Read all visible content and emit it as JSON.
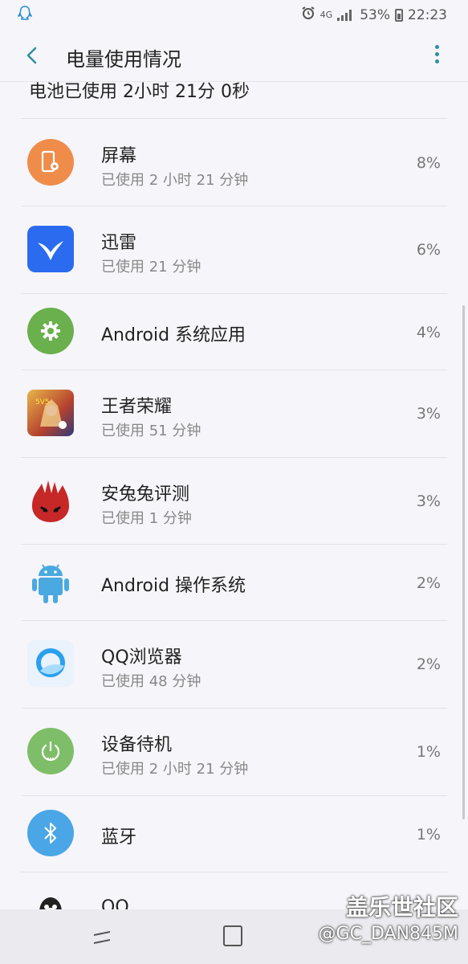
{
  "status_bar": {
    "network": "4G",
    "battery_percent": "53%",
    "time": "22:23",
    "icons": [
      "qq-notification-icon",
      "alarm-icon",
      "signal-icon",
      "battery-icon"
    ]
  },
  "app_bar": {
    "title": "电量使用情况",
    "back_icon": "chevron-left-icon",
    "more_icon": "more-vertical-icon"
  },
  "summary": "电池已使用 2小时 21分 0秒",
  "items": [
    {
      "name": "屏幕",
      "usage": "已使用 2 小时 21 分钟",
      "percent": "8%",
      "icon": "screen-icon",
      "color": "#ef8c4a"
    },
    {
      "name": "迅雷",
      "usage": "已使用 21 分钟",
      "percent": "6%",
      "icon": "xunlei-icon",
      "color": "#2a6bf0"
    },
    {
      "name": "Android 系统应用",
      "usage": "",
      "percent": "4%",
      "icon": "android-system-app-icon",
      "color": "#6ab04c"
    },
    {
      "name": "王者荣耀",
      "usage": "已使用 51 分钟",
      "percent": "3%",
      "icon": "honor-of-kings-icon",
      "color": "#b5412e"
    },
    {
      "name": "安兔兔评测",
      "usage": "已使用 1 分钟",
      "percent": "3%",
      "icon": "antutu-icon",
      "color": "#c62828"
    },
    {
      "name": "Android 操作系统",
      "usage": "",
      "percent": "2%",
      "icon": "android-os-icon",
      "color": "#4aa9e0"
    },
    {
      "name": "QQ浏览器",
      "usage": "已使用 48 分钟",
      "percent": "2%",
      "icon": "qq-browser-icon",
      "color": "#2aa0ef"
    },
    {
      "name": "设备待机",
      "usage": "已使用 2 小时 21 分钟",
      "percent": "1%",
      "icon": "power-standby-icon",
      "color": "#7fbe68"
    },
    {
      "name": "蓝牙",
      "usage": "",
      "percent": "1%",
      "icon": "bluetooth-icon",
      "color": "#4aa6e6"
    },
    {
      "name": "QQ",
      "usage": "",
      "percent": "",
      "icon": "qq-icon",
      "color": "#222222"
    }
  ],
  "watermark": {
    "line1": "盖乐世社区",
    "line2": "@GC_DAN845M"
  },
  "nav_bar": {
    "icons": [
      "recent-apps-icon",
      "home-icon"
    ]
  }
}
